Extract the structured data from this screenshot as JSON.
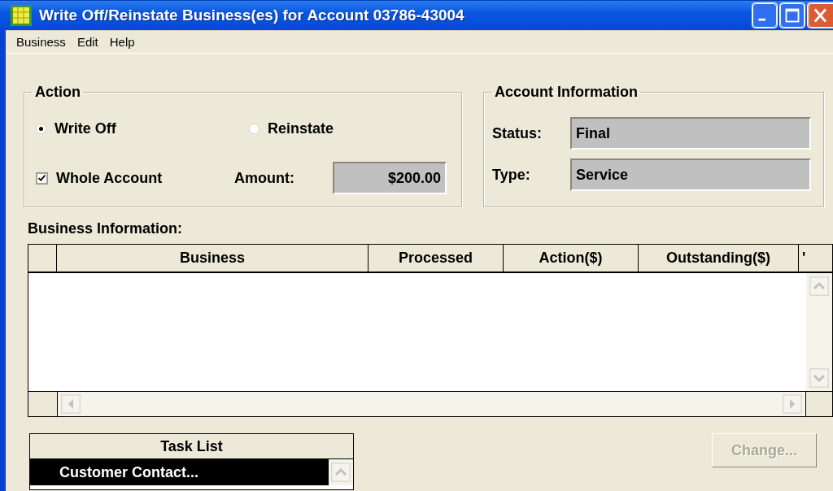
{
  "window": {
    "title": "Write Off/Reinstate Business(es) for Account 03786-43004"
  },
  "menu": [
    {
      "label": "Business"
    },
    {
      "label": "Edit"
    },
    {
      "label": "Help"
    }
  ],
  "action": {
    "title": "Action",
    "radios": [
      {
        "label": "Write Off",
        "selected": true
      },
      {
        "label": "Reinstate",
        "selected": false
      }
    ],
    "whole_account": {
      "label": "Whole Account",
      "checked": true
    },
    "amount": {
      "label": "Amount:",
      "value": "$200.00"
    }
  },
  "account_information": {
    "title": "Account Information",
    "fields": [
      {
        "label": "Status:",
        "value": "Final"
      },
      {
        "label": "Type:",
        "value": "Service"
      }
    ]
  },
  "business_information": {
    "title": "Business Information:",
    "columns": [
      "",
      "Business",
      "Processed",
      "Action($)",
      "Outstanding($)",
      "'"
    ]
  },
  "task_list": {
    "title": "Task List",
    "items": [
      {
        "label": "Customer Contact...",
        "selected": true
      }
    ]
  },
  "change_button": {
    "label": "Change...",
    "disabled": true
  }
}
